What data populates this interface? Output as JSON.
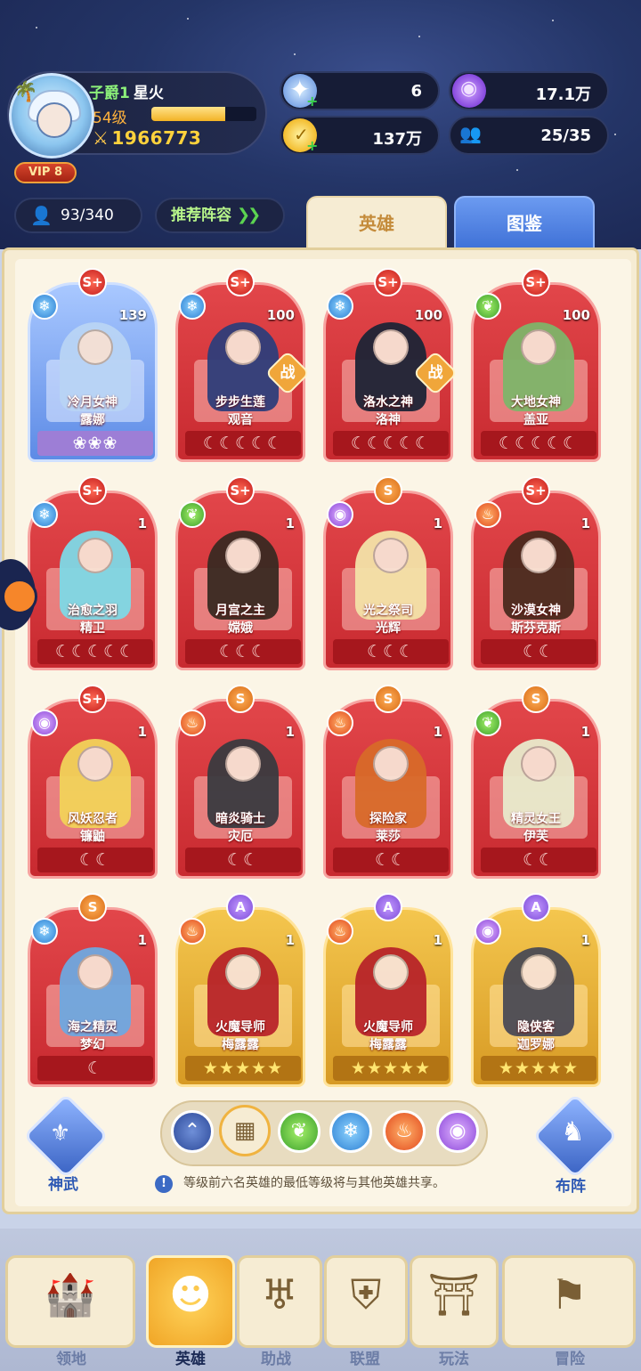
{
  "player": {
    "title": "子爵1",
    "name": "星火",
    "level": "54级",
    "xp_fraction": 0.7,
    "power": "1966773",
    "vip": "VIP 8"
  },
  "resources": [
    {
      "icon": "star-crystal-icon",
      "value": "6"
    },
    {
      "icon": "purple-gem-icon",
      "value": "17.1万"
    },
    {
      "icon": "gold-coin-icon",
      "value": "137万"
    },
    {
      "icon": "friends-icon",
      "value": "25/35"
    }
  ],
  "hero_count": "93/340",
  "recommend_label": "推荐阵容",
  "tabs": {
    "hero": "英雄",
    "book": "图鉴"
  },
  "heroes": [
    {
      "rank": "S+",
      "element": "ice",
      "level": "139",
      "title": "冷月女神",
      "name": "露娜",
      "stars": "❀❀❀",
      "style": "blue",
      "war": ""
    },
    {
      "rank": "S+",
      "element": "ice",
      "level": "100",
      "title": "步步生莲",
      "name": "观音",
      "stars": "☾☾☾☾☾",
      "style": "red",
      "war": "战"
    },
    {
      "rank": "S+",
      "element": "ice",
      "level": "100",
      "title": "洛水之神",
      "name": "洛神",
      "stars": "☾☾☾☾☾",
      "style": "red",
      "war": "战"
    },
    {
      "rank": "S+",
      "element": "nature",
      "level": "100",
      "title": "大地女神",
      "name": "盖亚",
      "stars": "☾☾☾☾☾",
      "style": "red",
      "war": ""
    },
    {
      "rank": "S+",
      "element": "ice",
      "level": "1",
      "title": "治愈之羽",
      "name": "精卫",
      "stars": "☾☾☾☾☾",
      "style": "red",
      "war": ""
    },
    {
      "rank": "S+",
      "element": "nature",
      "level": "1",
      "title": "月宫之主",
      "name": "嫦娥",
      "stars": "☾☾☾",
      "style": "red",
      "war": ""
    },
    {
      "rank": "S",
      "element": "light",
      "level": "1",
      "title": "光之祭司",
      "name": "光辉",
      "stars": "☾☾☾",
      "style": "red",
      "war": ""
    },
    {
      "rank": "S+",
      "element": "fire",
      "level": "1",
      "title": "沙漠女神",
      "name": "斯芬克斯",
      "stars": "☾☾",
      "style": "red",
      "war": ""
    },
    {
      "rank": "S+",
      "element": "light",
      "level": "1",
      "title": "风妖忍者",
      "name": "镰鼬",
      "stars": "☾☾",
      "style": "red",
      "war": ""
    },
    {
      "rank": "S",
      "element": "fire",
      "level": "1",
      "title": "暗炎骑士",
      "name": "灾厄",
      "stars": "☾☾",
      "style": "red",
      "war": ""
    },
    {
      "rank": "S",
      "element": "fire",
      "level": "1",
      "title": "探险家",
      "name": "莱莎",
      "stars": "☾☾",
      "style": "red",
      "war": ""
    },
    {
      "rank": "S",
      "element": "nature",
      "level": "1",
      "title": "精灵女王",
      "name": "伊芙",
      "stars": "☾☾",
      "style": "red",
      "war": ""
    },
    {
      "rank": "S",
      "element": "ice",
      "level": "1",
      "title": "海之精灵",
      "name": "梦幻",
      "stars": "☾",
      "style": "red",
      "war": ""
    },
    {
      "rank": "A",
      "element": "fire",
      "level": "1",
      "title": "火魔导师",
      "name": "梅露露",
      "stars": "★★★★★",
      "style": "gold",
      "war": ""
    },
    {
      "rank": "A",
      "element": "fire",
      "level": "1",
      "title": "火魔导师",
      "name": "梅露露",
      "stars": "★★★★★",
      "style": "gold",
      "war": ""
    },
    {
      "rank": "A",
      "element": "light",
      "level": "1",
      "title": "隐侠客",
      "name": "迦罗娜",
      "stars": "★★★★★",
      "style": "gold",
      "war": ""
    }
  ],
  "bottom_actions": {
    "shenwu": "神武",
    "buzhen": "布阵"
  },
  "filters": [
    "sort-up-icon",
    "all-grid-icon",
    "nature-element-icon",
    "ice-element-icon",
    "fire-element-icon",
    "light-element-icon"
  ],
  "notice": "等级前六名英雄的最低等级将与其他英雄共享。",
  "nav": [
    {
      "label": "领地",
      "icon": "castle-icon"
    },
    {
      "label": "英雄",
      "icon": "hero-face-icon",
      "active": true
    },
    {
      "label": "助战",
      "icon": "support-pillar-icon"
    },
    {
      "label": "联盟",
      "icon": "alliance-banner-icon"
    },
    {
      "label": "玩法",
      "icon": "gate-icon"
    },
    {
      "label": "冒险",
      "icon": "flag-icon"
    }
  ],
  "colors": {
    "card_red": "#d8383e",
    "card_gold": "#e6b03a",
    "accent_blue": "#3d6fd6",
    "green_name": "#8cf07a"
  }
}
